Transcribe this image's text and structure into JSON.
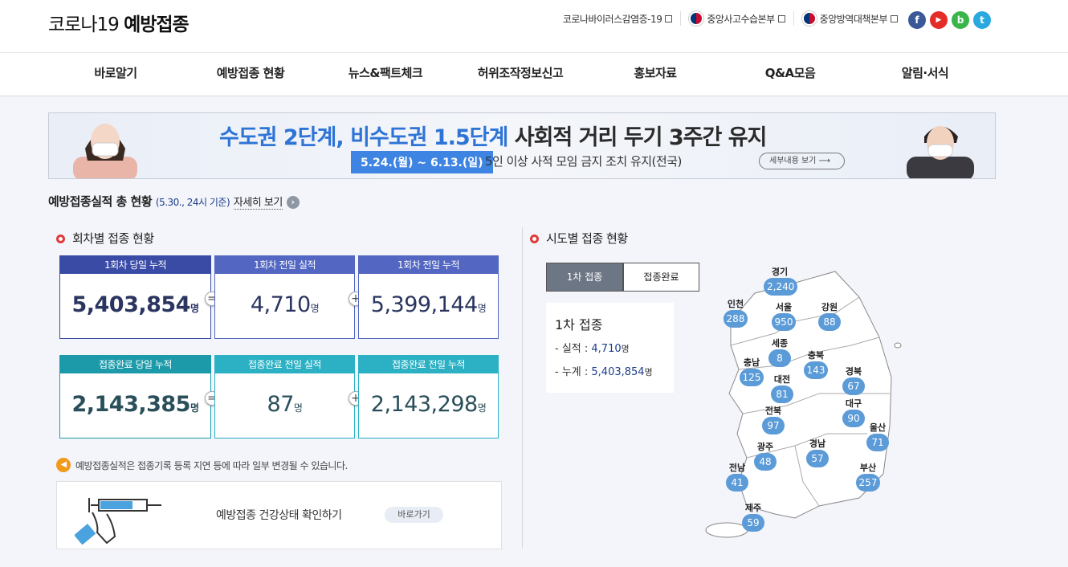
{
  "header": {
    "title_prefix": "코로나19",
    "title_main": "예방접종",
    "links": [
      {
        "label": "코로나바이러스감염증-19"
      },
      {
        "label": "중앙사고수습본부"
      },
      {
        "label": "중앙방역대책본부"
      }
    ],
    "social": [
      {
        "icon": "facebook-icon",
        "glyph": "f",
        "color": "#3b5998"
      },
      {
        "icon": "youtube-icon",
        "glyph": "▶",
        "color": "#e52d27"
      },
      {
        "icon": "blog-icon",
        "glyph": "b",
        "color": "#39b54a"
      },
      {
        "icon": "twitter-icon",
        "glyph": "t",
        "color": "#2aa9e0"
      }
    ]
  },
  "nav": [
    "바로알기",
    "예방접종 현황",
    "뉴스&팩트체크",
    "허위조작정보신고",
    "홍보자료",
    "Q&A모음",
    "알림·서식"
  ],
  "banner": {
    "title_blue1": "수도권 2단계,",
    "title_blue2": "비수도권 1.5단계",
    "title_dark": "사회적 거리 두기 3주간 유지",
    "date": "5.24.(월) ~ 6.13.(일)",
    "desc": "5인 이상 사적 모임 금지 조치 유지(전국)",
    "button": "세부내용 보기"
  },
  "summary": {
    "title": "예방접종실적 총 현황",
    "date": "(5.30., 24시 기준)",
    "more": "자세히 보기"
  },
  "dose": {
    "title": "회차별 접종 현황",
    "unit": "명",
    "first": [
      {
        "label": "1회차 당일 누적",
        "value": "5,403,854",
        "color": "#3a4ba6"
      },
      {
        "label": "1회차 전일 실적",
        "value": "4,710",
        "color": "#5266c2"
      },
      {
        "label": "1회차 전일 누적",
        "value": "5,399,144",
        "color": "#5266c2"
      }
    ],
    "complete": [
      {
        "label": "접종완료 당일 누적",
        "value": "2,143,385",
        "color": "#1c9aaa"
      },
      {
        "label": "접종완료 전일 실적",
        "value": "87",
        "color": "#2bb0c4"
      },
      {
        "label": "접종완료 전일 누적",
        "value": "2,143,298",
        "color": "#2bb0c4"
      }
    ],
    "ops": [
      "=",
      "+"
    ]
  },
  "notice": "예방접종실적은 접종기록 등록 지연 등에 따라 일부 변경될 수 있습니다.",
  "health": {
    "text": "예방접종 건강상태 확인하기",
    "button": "바로가기"
  },
  "region": {
    "title": "시도별 접종 현황",
    "tabs": [
      "1차 접종",
      "접종완료"
    ],
    "detail_title": "1차 접종",
    "rows": [
      {
        "label": "실적 :",
        "value": "4,710"
      },
      {
        "label": "누계 :",
        "value": "5,403,854"
      }
    ],
    "unit": "명",
    "map": [
      {
        "name": "경기",
        "value": "2,240"
      },
      {
        "name": "인천",
        "value": "288"
      },
      {
        "name": "서울",
        "value": "950"
      },
      {
        "name": "강원",
        "value": "88"
      },
      {
        "name": "세종",
        "value": "8"
      },
      {
        "name": "충남",
        "value": "125"
      },
      {
        "name": "충북",
        "value": "143"
      },
      {
        "name": "대전",
        "value": "81"
      },
      {
        "name": "경북",
        "value": "67"
      },
      {
        "name": "전북",
        "value": "97"
      },
      {
        "name": "대구",
        "value": "90"
      },
      {
        "name": "울산",
        "value": "71"
      },
      {
        "name": "광주",
        "value": "48"
      },
      {
        "name": "경남",
        "value": "57"
      },
      {
        "name": "전남",
        "value": "41"
      },
      {
        "name": "부산",
        "value": "257"
      },
      {
        "name": "제주",
        "value": "59"
      }
    ]
  }
}
